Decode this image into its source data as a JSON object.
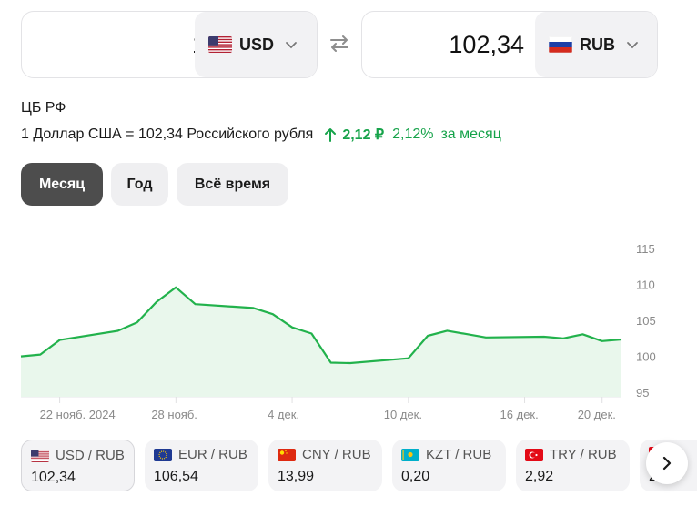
{
  "converter": {
    "from": {
      "amount": "1",
      "currency": "USD",
      "flag_icon": "us-flag-icon"
    },
    "to": {
      "amount": "102,34",
      "currency": "RUB",
      "flag_icon": "ru-flag-icon"
    }
  },
  "rate": {
    "source": "ЦБ РФ",
    "text": "1 Доллар США = 102,34 Российского рубля",
    "change_abs": "2,12 ₽",
    "change_pct": "2,12%",
    "change_period": "за месяц",
    "trend": "up"
  },
  "periods": [
    {
      "label": "Месяц",
      "active": true
    },
    {
      "label": "Год",
      "active": false
    },
    {
      "label": "Всё время",
      "active": false
    }
  ],
  "chart_data": {
    "type": "area",
    "x": [
      "2024-11-20",
      "2024-11-21",
      "2024-11-22",
      "2024-11-25",
      "2024-11-26",
      "2024-11-27",
      "2024-11-28",
      "2024-11-29",
      "2024-12-02",
      "2024-12-03",
      "2024-12-04",
      "2024-12-05",
      "2024-12-06",
      "2024-12-07",
      "2024-12-10",
      "2024-12-11",
      "2024-12-12",
      "2024-12-13",
      "2024-12-14",
      "2024-12-17",
      "2024-12-18",
      "2024-12-19",
      "2024-12-20",
      "2024-12-21"
    ],
    "y": [
      99.99,
      100.24,
      102.27,
      103.54,
      104.72,
      107.56,
      109.58,
      107.25,
      106.72,
      105.86,
      104.02,
      103.17,
      99.11,
      99.05,
      99.72,
      102.85,
      103.56,
      103.09,
      102.62,
      102.72,
      102.5,
      103.06,
      102.12,
      102.34
    ],
    "x_tick_labels": [
      "22 нояб. 2024",
      "28 нояб.",
      "4 дек.",
      "10 дек.",
      "16 дек.",
      "20 дек."
    ],
    "y_ticks": [
      95,
      100,
      105,
      110,
      115
    ],
    "ylim": [
      95,
      115
    ],
    "line_color": "#22b24c",
    "fill_color": "#e9f7ec",
    "grid": "vertical"
  },
  "cards": [
    {
      "pair": "USD / RUB",
      "value": "102,34",
      "flag_icon": "us-flag-icon",
      "active": true
    },
    {
      "pair": "EUR / RUB",
      "value": "106,54",
      "flag_icon": "eu-flag-icon",
      "active": false
    },
    {
      "pair": "CNY / RUB",
      "value": "13,99",
      "flag_icon": "cn-flag-icon",
      "active": false
    },
    {
      "pair": "KZT / RUB",
      "value": "0,20",
      "flag_icon": "kz-flag-icon",
      "active": false
    },
    {
      "pair": "TRY / RUB",
      "value": "2,92",
      "flag_icon": "tr-flag-icon",
      "active": false
    },
    {
      "pair": "",
      "value": "2",
      "flag_icon": "next-flag-icon",
      "active": false
    }
  ],
  "colors": {
    "positive": "#16a34a",
    "active_period": "#4d4d4d"
  }
}
